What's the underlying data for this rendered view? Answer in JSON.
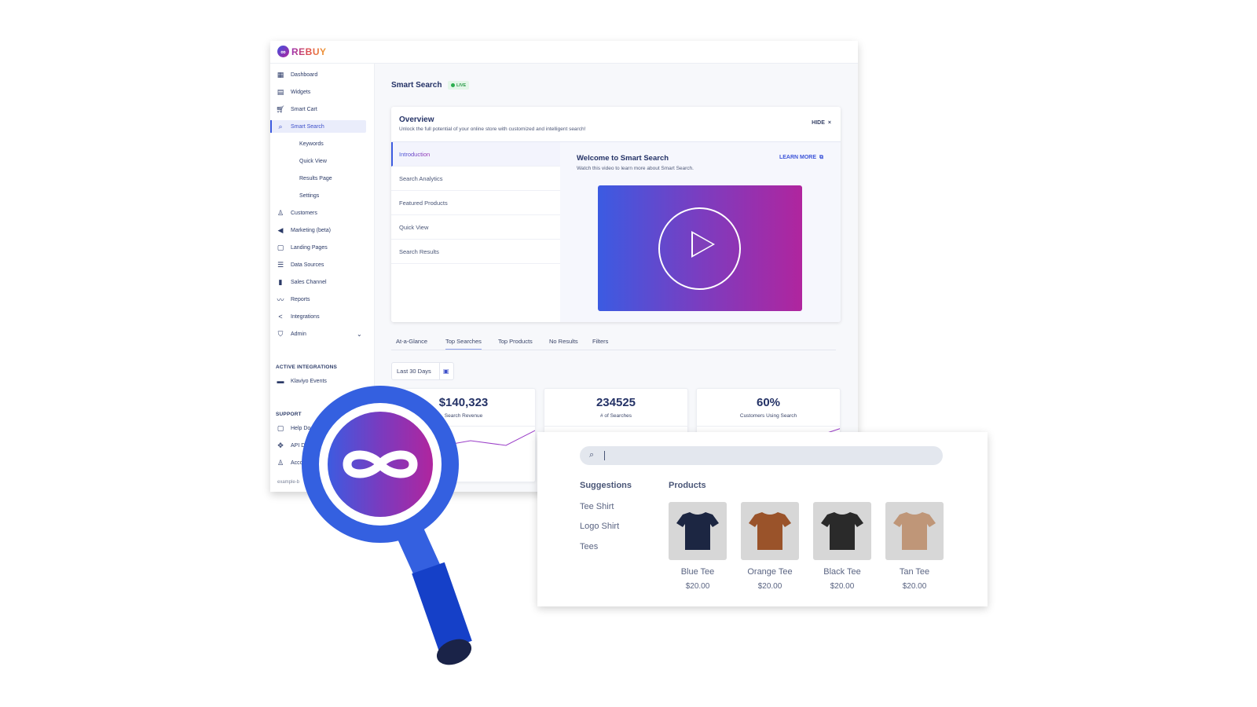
{
  "app": {
    "brand": "REBUY",
    "sidebar": {
      "items": [
        {
          "label": "Dashboard",
          "icon": "dashboard-icon"
        },
        {
          "label": "Widgets",
          "icon": "widgets-icon"
        },
        {
          "label": "Smart Cart",
          "icon": "cart-icon"
        },
        {
          "label": "Smart Search",
          "icon": "search-icon",
          "active": true
        },
        {
          "label": "Keywords",
          "sub": true
        },
        {
          "label": "Quick View",
          "sub": true
        },
        {
          "label": "Results Page",
          "sub": true
        },
        {
          "label": "Settings",
          "sub": true
        },
        {
          "label": "Customers",
          "icon": "customers-icon"
        },
        {
          "label": "Marketing (beta)",
          "icon": "megaphone-icon"
        },
        {
          "label": "Landing Pages",
          "icon": "landing-page-icon"
        },
        {
          "label": "Data Sources",
          "icon": "list-icon"
        },
        {
          "label": "Sales Channel",
          "icon": "phone-icon"
        },
        {
          "label": "Reports",
          "icon": "chart-line-icon"
        },
        {
          "label": "Integrations",
          "icon": "share-icon"
        },
        {
          "label": "Admin",
          "icon": "admin-icon"
        }
      ],
      "active_integrations_heading": "ACTIVE INTEGRATIONS",
      "active_integrations": [
        {
          "label": "Klaviyo Events",
          "icon": "flag-icon"
        }
      ],
      "support_heading": "SUPPORT",
      "support": [
        {
          "label": "Help Docs",
          "icon": "help-doc-icon"
        },
        {
          "label": "API Docs",
          "icon": "api-icon"
        },
        {
          "label": "Account",
          "icon": "user-icon"
        }
      ],
      "footer": "example-b"
    },
    "page_title": "Smart Search",
    "live_badge": "LIVE",
    "overview": {
      "title": "Overview",
      "subtitle": "Unlock the full potential of your online store with customized and intelligent search!",
      "hide_label": "HIDE",
      "tabs": [
        "Introduction",
        "Search Analytics",
        "Featured Products",
        "Quick View",
        "Search Results"
      ],
      "active_tab": "Introduction",
      "welcome_title": "Welcome to Smart Search",
      "welcome_sub": "Watch this video to learn more about Smart Search.",
      "learn_more": "LEARN MORE"
    },
    "analytics_tabs": [
      "At-a-Glance",
      "Top Searches",
      "Top Products",
      "No Results",
      "Filters"
    ],
    "active_analytics_tab": "Top Searches",
    "date_range": "Last 30 Days",
    "stats": [
      {
        "value": "$140,323",
        "label": "Search Revenue"
      },
      {
        "value": "234525",
        "label": "# of Searches"
      },
      {
        "value": "60%",
        "label": "Customers Using Search"
      }
    ]
  },
  "search_panel": {
    "query": "",
    "suggestions_heading": "Suggestions",
    "suggestions": [
      "Tee Shirt",
      "Logo Shirt",
      "Tees"
    ],
    "products_heading": "Products",
    "products": [
      {
        "name": "Blue Tee",
        "price": "$20.00",
        "color": "#1c2642"
      },
      {
        "name": "Orange Tee",
        "price": "$20.00",
        "color": "#9a532a"
      },
      {
        "name": "Black Tee",
        "price": "$20.00",
        "color": "#2a2a2a"
      },
      {
        "name": "Tan Tee",
        "price": "$20.00",
        "color": "#bf9678"
      }
    ]
  },
  "colors": {
    "accent_blue": "#3d5be0",
    "accent_magenta": "#b0259e",
    "magnifier_blue": "#3460e0",
    "live_green": "#2cae4f"
  }
}
